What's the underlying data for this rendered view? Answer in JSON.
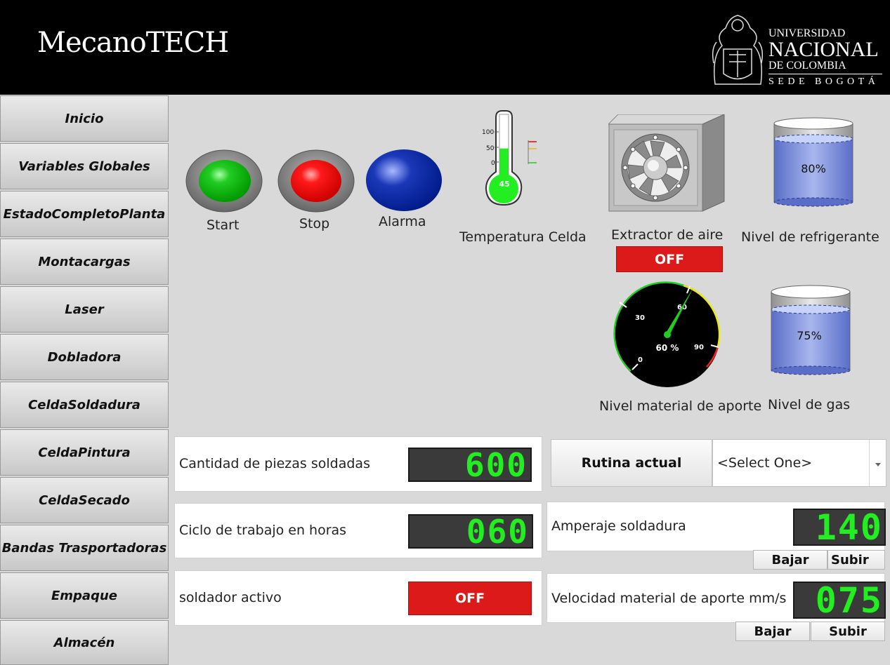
{
  "header": {
    "app_title": "MecanoTECH",
    "university": {
      "line1": "UNIVERSIDAD",
      "line2": "NACIONAL",
      "line3": "DE COLOMBIA",
      "line4": "SEDE BOGOTÁ"
    }
  },
  "sidebar": {
    "items": [
      {
        "label": "Inicio"
      },
      {
        "label": "Variables Globales"
      },
      {
        "label": "EstadoCompletoPlanta"
      },
      {
        "label": "Montacargas"
      },
      {
        "label": "Laser"
      },
      {
        "label": "Dobladora"
      },
      {
        "label": "CeldaSoldadura"
      },
      {
        "label": "CeldaPintura"
      },
      {
        "label": "CeldaSecado"
      },
      {
        "label": "Bandas Trasportadoras"
      },
      {
        "label": "Empaque"
      },
      {
        "label": "Almacén"
      }
    ]
  },
  "controls": {
    "start_label": "Start",
    "stop_label": "Stop",
    "alarm_label": "Alarma"
  },
  "thermometer": {
    "label": "Temperatura Celda",
    "value": "45",
    "scale": [
      "100",
      "50",
      "0"
    ]
  },
  "extractor": {
    "label": "Extractor de aire",
    "state": "OFF"
  },
  "coolant_tank": {
    "label": "Nivel de refrigerante",
    "value": "80%",
    "fill": 0.8
  },
  "gas_tank": {
    "label": "Nivel de gas",
    "value": "75%",
    "fill": 0.75
  },
  "gauge": {
    "label": "Nivel material de aporte",
    "value": 60,
    "value_text": "60 %",
    "ticks": [
      "0",
      "30",
      "60",
      "90"
    ]
  },
  "counters": {
    "pieces_label": "Cantidad de piezas soldadas",
    "pieces_value": "600",
    "hours_label": "Ciclo de trabajo en horas",
    "hours_value": "060",
    "welder_label": "soldador activo",
    "welder_state": "OFF"
  },
  "routine": {
    "label": "Rutina actual",
    "selected": "<Select One>"
  },
  "amperage": {
    "label": "Amperaje soldadura",
    "value": "140",
    "down_label": "Bajar",
    "up_label": "Subir"
  },
  "feed_speed": {
    "label": "Velocidad material de aporte mm/s",
    "value": "075",
    "down_label": "Bajar",
    "up_label": "Subir"
  },
  "colors": {
    "start": "#11bb11",
    "stop": "#ee1111",
    "alarm": "#0a2aa0",
    "off_button": "#dd1a1a",
    "digits": "#22ee22"
  }
}
